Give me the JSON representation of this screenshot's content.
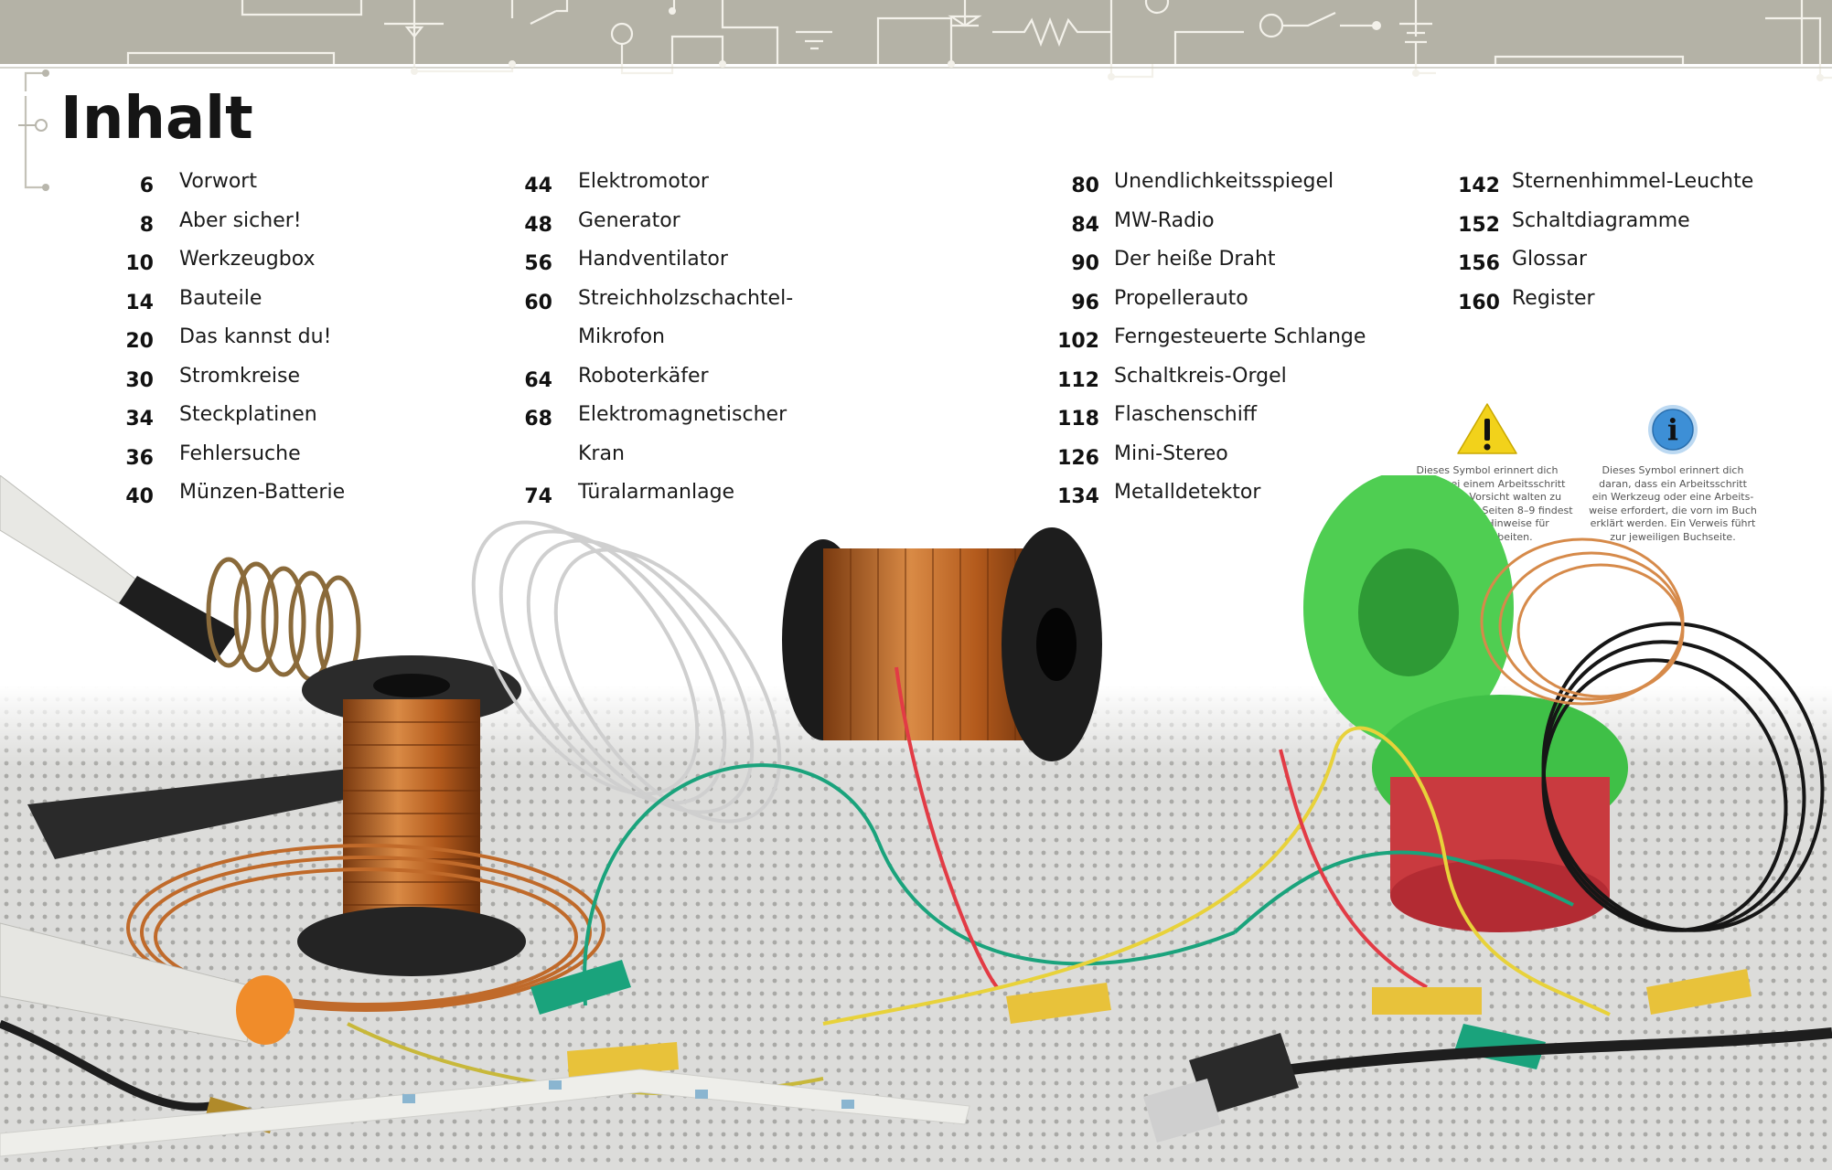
{
  "title": "Inhalt",
  "toc": [
    [
      {
        "page": "6",
        "title": [
          "Vorwort"
        ]
      },
      {
        "page": "8",
        "title": [
          "Aber sicher!"
        ]
      },
      {
        "page": "10",
        "title": [
          "Werkzeugbox"
        ]
      },
      {
        "page": "14",
        "title": [
          "Bauteile"
        ]
      },
      {
        "page": "20",
        "title": [
          "Das kannst du!"
        ]
      },
      {
        "page": "30",
        "title": [
          "Stromkreise"
        ]
      },
      {
        "page": "34",
        "title": [
          "Steckplatinen"
        ]
      },
      {
        "page": "36",
        "title": [
          "Fehlersuche"
        ]
      },
      {
        "page": "40",
        "title": [
          "Münzen-Batterie"
        ]
      }
    ],
    [
      {
        "page": "44",
        "title": [
          "Elektromotor"
        ]
      },
      {
        "page": "48",
        "title": [
          "Generator"
        ]
      },
      {
        "page": "56",
        "title": [
          "Handventilator"
        ]
      },
      {
        "page": "60",
        "title": [
          "Streichholzschachtel-",
          "Mikrofon"
        ]
      },
      {
        "page": "64",
        "title": [
          "Roboterkäfer"
        ]
      },
      {
        "page": "68",
        "title": [
          "Elektromagnetischer",
          "Kran"
        ]
      },
      {
        "page": "74",
        "title": [
          "Türalarmanlage"
        ]
      }
    ],
    [
      {
        "page": "80",
        "title": [
          "Unendlichkeitsspiegel"
        ]
      },
      {
        "page": "84",
        "title": [
          "MW-Radio"
        ]
      },
      {
        "page": "90",
        "title": [
          "Der heiße Draht"
        ]
      },
      {
        "page": "96",
        "title": [
          "Propellerauto"
        ]
      },
      {
        "page": "102",
        "title": [
          "Ferngesteuerte Schlange"
        ]
      },
      {
        "page": "112",
        "title": [
          "Schaltkreis-Orgel"
        ]
      },
      {
        "page": "118",
        "title": [
          "Flaschenschiff"
        ]
      },
      {
        "page": "126",
        "title": [
          "Mini-Stereo"
        ]
      },
      {
        "page": "134",
        "title": [
          "Metalldetektor"
        ]
      }
    ],
    [
      {
        "page": "142",
        "title": [
          "Sternenhimmel-Leuchte"
        ]
      },
      {
        "page": "152",
        "title": [
          "Schaltdiagramme"
        ]
      },
      {
        "page": "156",
        "title": [
          "Glossar"
        ]
      },
      {
        "page": "160",
        "title": [
          "Register"
        ]
      }
    ]
  ],
  "notes": {
    "warning": {
      "icon": "warning-triangle-icon",
      "lines": [
        "Dieses Symbol erinnert dich",
        "daran, bei einem Arbeitsschritt",
        "besondere Vorsicht walten zu",
        "lassen. Auf den Seiten 8–9 findest",
        "du wichtige Hinweise für",
        "sicheres Arbeiten."
      ]
    },
    "info": {
      "icon": "info-circle-icon",
      "lines": [
        "Dieses Symbol erinnert dich",
        "daran, dass ein Arbeitsschritt",
        "ein Werkzeug oder eine Arbeits-",
        "weise erfordert, die vorn im Buch",
        "erklärt werden. Ein Verweis führt",
        "zur jeweiligen Buchseite."
      ]
    }
  },
  "colors": {
    "header_band": "#b4b2a6",
    "circuit_line": "#f3f1ea",
    "warning_yellow": "#f2d21b",
    "info_blue": "#3d8fd6"
  }
}
